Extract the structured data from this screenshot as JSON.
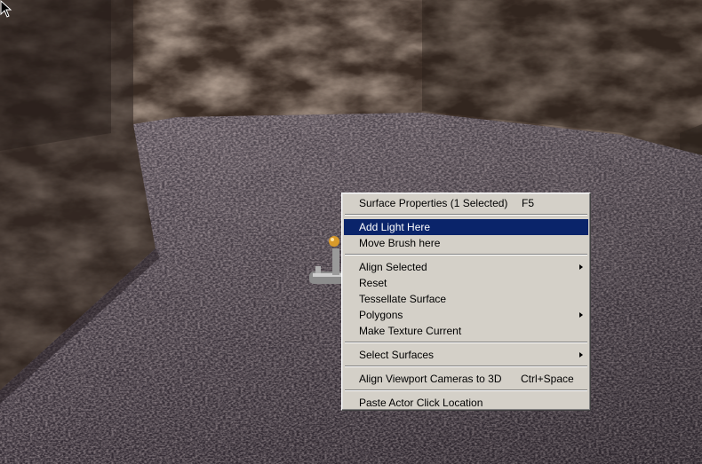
{
  "context_menu": {
    "items": [
      {
        "label": "Surface Properties (1 Selected)",
        "shortcut": "F5"
      },
      {
        "label": "Add Light Here"
      },
      {
        "label": "Move Brush here"
      },
      {
        "label": "Align Selected"
      },
      {
        "label": "Reset"
      },
      {
        "label": "Tessellate Surface"
      },
      {
        "label": "Polygons"
      },
      {
        "label": "Make Texture Current"
      },
      {
        "label": "Select Surfaces"
      },
      {
        "label": "Align Viewport Cameras to 3D",
        "shortcut": "Ctrl+Space"
      },
      {
        "label": "Paste Actor Click Location"
      }
    ],
    "highlighted_index": 1
  },
  "colors": {
    "menu_background": "#d4d0c8",
    "highlight": "#0a246a",
    "highlight_text": "#ffffff"
  },
  "icons": {
    "cursor": "arrow-cursor-icon",
    "light_actor": "light-bulb-icon",
    "submenu": "chevron-right-icon"
  }
}
